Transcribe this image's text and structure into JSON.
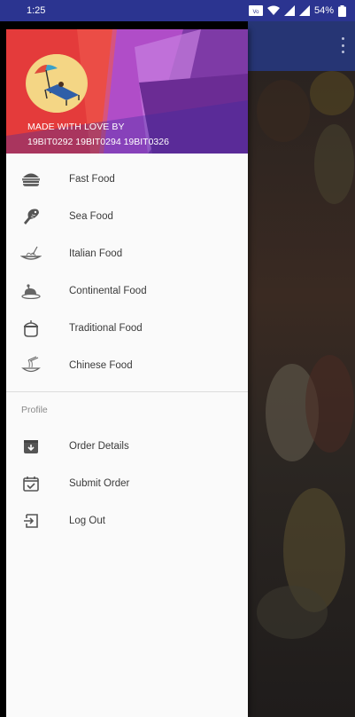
{
  "status_bar": {
    "time": "1:25",
    "battery": "54%"
  },
  "header": {
    "made_with": "MADE WITH LOVE BY",
    "ids": "19BIT0292 19BIT0294 19BIT0326"
  },
  "menu": {
    "food_items": [
      {
        "label": "Fast Food",
        "icon": "burger-icon"
      },
      {
        "label": "Sea Food",
        "icon": "fish-icon"
      },
      {
        "label": "Italian Food",
        "icon": "pasta-icon"
      },
      {
        "label": "Continental Food",
        "icon": "roast-chicken-icon"
      },
      {
        "label": "Traditional Food",
        "icon": "pot-icon"
      },
      {
        "label": "Chinese Food",
        "icon": "noodles-icon"
      }
    ],
    "section_title": "Profile",
    "profile_items": [
      {
        "label": "Order Details",
        "icon": "archive-icon"
      },
      {
        "label": "Submit Order",
        "icon": "calendar-check-icon"
      },
      {
        "label": "Log Out",
        "icon": "logout-icon"
      }
    ]
  },
  "colors": {
    "status_bar": "#2b3490",
    "app_bar": "#263574",
    "drawer_bg": "#fafafa",
    "header_red": "#e33a3c",
    "header_purple": "#8a2c9c"
  }
}
